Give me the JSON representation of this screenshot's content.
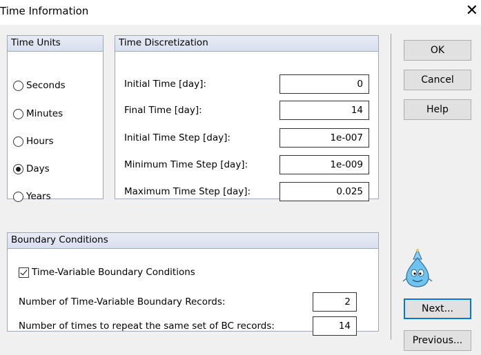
{
  "window": {
    "title": "Time Information",
    "close_glyph": "✕"
  },
  "time_units": {
    "header": "Time Units",
    "options": [
      "Seconds",
      "Minutes",
      "Hours",
      "Days",
      "Years"
    ],
    "selected": "Days"
  },
  "time_discretization": {
    "header": "Time Discretization",
    "fields": [
      {
        "label": "Initial Time [day]:",
        "value": "0"
      },
      {
        "label": "Final Time [day]:",
        "value": "14"
      },
      {
        "label": "Initial Time Step [day]:",
        "value": "1e-007"
      },
      {
        "label": "Minimum Time Step [day]:",
        "value": "1e-009"
      },
      {
        "label": "Maximum Time Step [day]:",
        "value": "0.025"
      }
    ]
  },
  "boundary_conditions": {
    "header": "Boundary Conditions",
    "checkbox_label": "Time-Variable Boundary Conditions",
    "checked": true,
    "records_label": "Number of Time-Variable Boundary Records:",
    "records_value": "2",
    "repeat_label": "Number of times to repeat the same set of BC records:",
    "repeat_value": "14"
  },
  "buttons": {
    "ok": "OK",
    "cancel": "Cancel",
    "help": "Help",
    "next": "Next...",
    "previous": "Previous..."
  },
  "colors": {
    "accent": "#0078d7",
    "group_header": "#dce3f0",
    "dialog_bg": "#f0f0f0",
    "mascot": "#6ec3ef"
  },
  "icons": {
    "mascot": "water-drop-mascot-icon",
    "close": "close-icon"
  }
}
